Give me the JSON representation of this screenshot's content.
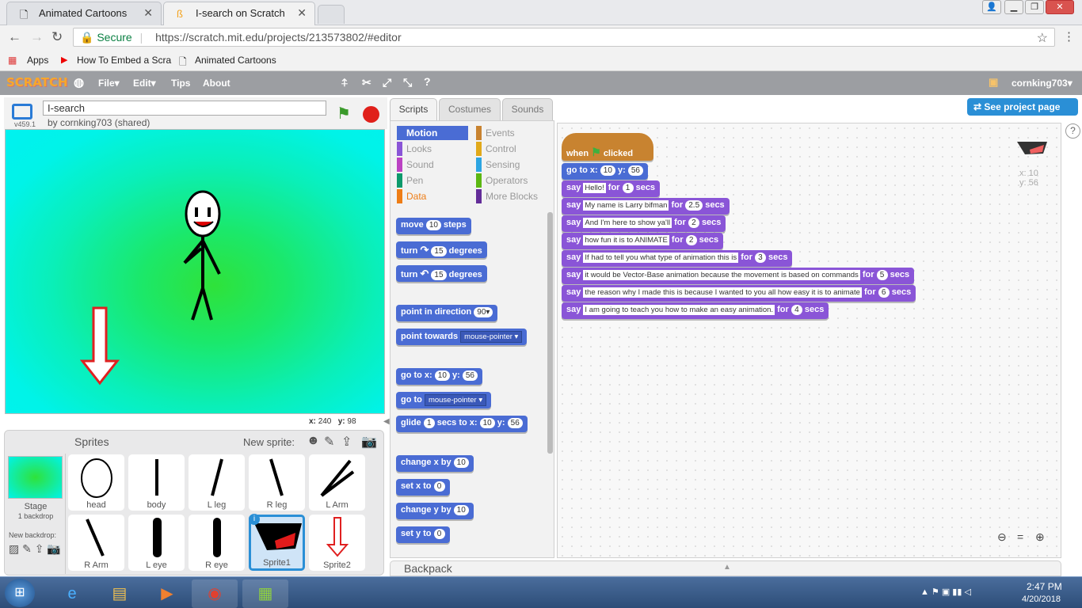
{
  "browser": {
    "tabs": [
      {
        "title": "Animated Cartoons",
        "icon": "document-icon"
      },
      {
        "title": "I-search on Scratch",
        "icon": "scratch-icon"
      }
    ],
    "address": {
      "secure_label": "Secure",
      "url": "https://scratch.mit.edu/projects/213573802/#editor"
    },
    "bookmarks": [
      "Apps",
      "How To Embed a Scra",
      "Animated Cartoons"
    ]
  },
  "scratch_menu": {
    "logo": "SCRATCH",
    "items": [
      "File▾",
      "Edit▾",
      "Tips",
      "About"
    ],
    "user": "cornking703▾"
  },
  "stage": {
    "version": "v459.1",
    "title": "I-search",
    "byline": "by cornking703 (shared)",
    "x_label": "x:",
    "x_value": "240",
    "y_label": "y:",
    "y_value": "98"
  },
  "sprites": {
    "header": "Sprites",
    "new_sprite": "New sprite:",
    "stage_label": "Stage",
    "stage_sub": "1 backdrop",
    "new_backdrop": "New backdrop:",
    "items": [
      "head",
      "body",
      "L leg",
      "R leg",
      "L Arm",
      "R Arm",
      "L eye",
      "R eye",
      "Sprite1",
      "Sprite2"
    ],
    "selected": "Sprite1"
  },
  "editor_tabs": [
    "Scripts",
    "Costumes",
    "Sounds"
  ],
  "see_project": "See project page",
  "categories": {
    "left": [
      "Motion",
      "Looks",
      "Sound",
      "Pen",
      "Data"
    ],
    "right": [
      "Events",
      "Control",
      "Sensing",
      "Operators",
      "More Blocks"
    ],
    "colors": {
      "Motion": "#4a6cd4",
      "Looks": "#8a55d7",
      "Sound": "#bb42c3",
      "Pen": "#0e9a6c",
      "Data": "#ee7d16",
      "Events": "#c88330",
      "Control": "#e1a91a",
      "Sensing": "#2ca5e2",
      "Operators": "#5cb712",
      "More Blocks": "#632d99"
    }
  },
  "palette": {
    "move": [
      "move",
      "10",
      "steps"
    ],
    "turn_right": [
      "turn",
      "15",
      "degrees"
    ],
    "turn_left": [
      "turn",
      "15",
      "degrees"
    ],
    "point_dir": [
      "point in direction",
      "90▾"
    ],
    "point_towards": [
      "point towards",
      "mouse-pointer ▾"
    ],
    "goto_xy": [
      "go to x:",
      "10",
      "y:",
      "56"
    ],
    "goto": [
      "go to",
      "mouse-pointer ▾"
    ],
    "glide": [
      "glide",
      "1",
      "secs to x:",
      "10",
      "y:",
      "56"
    ],
    "change_x": [
      "change x by",
      "10"
    ],
    "set_x": [
      "set x to",
      "0"
    ],
    "change_y": [
      "change y by",
      "10"
    ],
    "set_y": [
      "set y to",
      "0"
    ]
  },
  "script": {
    "hat": {
      "when": "when",
      "clicked": "clicked"
    },
    "goto": {
      "label": "go to x:",
      "x": "10",
      "ylabel": "y:",
      "y": "56"
    },
    "says": [
      {
        "text": "Hello!",
        "secs": "1"
      },
      {
        "text": "My name is Larry bifman",
        "secs": "2.5"
      },
      {
        "text": "And I'm here to show ya'll",
        "secs": "2"
      },
      {
        "text": "how fun it is to ANIMATE",
        "secs": "2"
      },
      {
        "text": "If had to tell you what type of animation this is",
        "secs": "3"
      },
      {
        "text": "it would be Vector-Base animation because the movement is based on commands",
        "secs": "5"
      },
      {
        "text": "the reason why I made this is because I wanted to you all how easy it is to animate",
        "secs": "6"
      },
      {
        "text": "I am going to teach you how to make an easy animation.",
        "secs": "4"
      }
    ],
    "say": "say",
    "for": "for",
    "secs_word": "secs",
    "sprite_x": "x: 10",
    "sprite_y": "y: 56"
  },
  "backpack": "Backpack",
  "taskbar": {
    "time": "2:47 PM",
    "date": "4/20/2018"
  }
}
